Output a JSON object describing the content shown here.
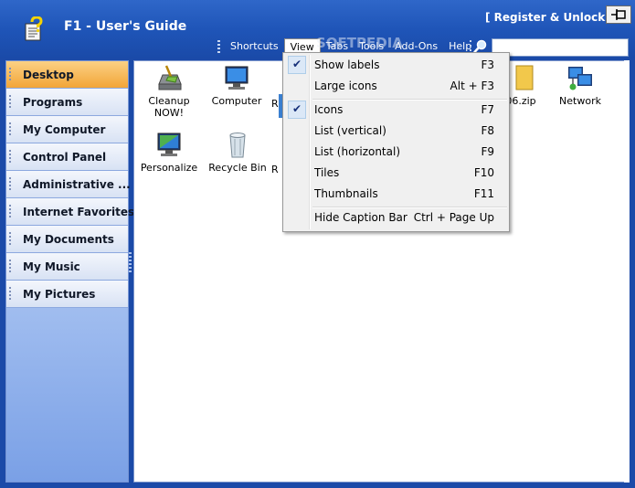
{
  "header": {
    "title": "F1 - User's Guide",
    "register_label": "[ Register & Unlock ]"
  },
  "menubar": {
    "items": [
      {
        "label": "Shortcuts"
      },
      {
        "label": "View"
      },
      {
        "label": "Tabs"
      },
      {
        "label": "Tools"
      },
      {
        "label": "Add-Ons"
      },
      {
        "label": "Help"
      }
    ]
  },
  "sidebar": {
    "items": [
      {
        "label": "Desktop",
        "selected": true
      },
      {
        "label": "Programs"
      },
      {
        "label": "My Computer"
      },
      {
        "label": "Control Panel"
      },
      {
        "label": "Administrative ..."
      },
      {
        "label": "Internet Favorites"
      },
      {
        "label": "My Documents"
      },
      {
        "label": "My Music"
      },
      {
        "label": "My Pictures"
      }
    ]
  },
  "files": [
    {
      "label": "Cleanup NOW!",
      "icon": "cleanup-icon"
    },
    {
      "label": "Computer",
      "icon": "computer-icon"
    },
    {
      "label": "R",
      "icon": "partially-hidden-icon"
    },
    {
      "label": "06.zip",
      "icon": "zip-file-icon"
    },
    {
      "label": "Network",
      "icon": "network-icon"
    },
    {
      "label": "Personalize",
      "icon": "personalize-icon"
    },
    {
      "label": "Recycle Bin",
      "icon": "recycle-bin-icon"
    },
    {
      "label": "R",
      "icon": "partially-hidden-icon"
    }
  ],
  "view_menu": {
    "items": [
      {
        "label": "Show labels",
        "shortcut": "F3",
        "checked": true
      },
      {
        "label": "Large icons",
        "shortcut": "Alt + F3",
        "checked": false
      },
      {
        "label": "Icons",
        "shortcut": "F7",
        "checked": true
      },
      {
        "label": "List (vertical)",
        "shortcut": "F8",
        "checked": false
      },
      {
        "label": "List (horizontal)",
        "shortcut": "F9",
        "checked": false
      },
      {
        "label": "Tiles",
        "shortcut": "F10",
        "checked": false
      },
      {
        "label": "Thumbnails",
        "shortcut": "F11",
        "checked": false
      },
      {
        "label": "Hide Caption Bar",
        "shortcut": "Ctrl + Page Up",
        "checked": false
      }
    ]
  },
  "watermark": "SOFTPEDIA",
  "colors": {
    "header_blue": "#1f55b8",
    "selected_orange": "#f2a538",
    "menu_bg": "#f0f0f0"
  }
}
